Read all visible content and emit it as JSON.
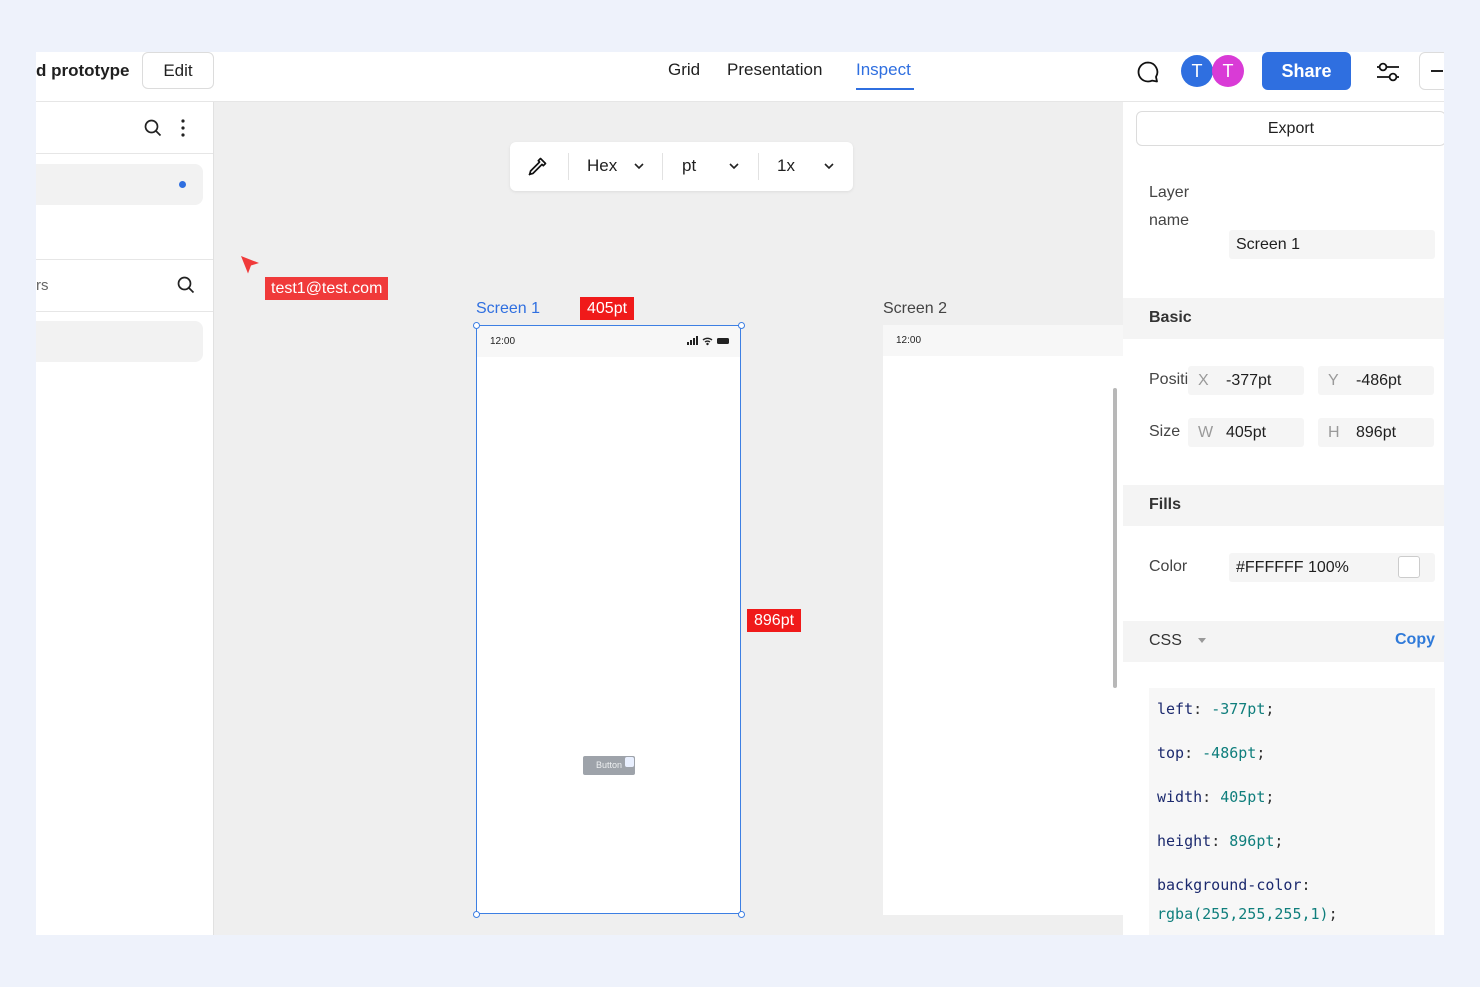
{
  "header": {
    "project_title": "d prototype",
    "edit_label": "Edit",
    "tabs": [
      {
        "label": "Grid"
      },
      {
        "label": "Presentation"
      },
      {
        "label": "Inspect",
        "active": true
      }
    ],
    "avatars": [
      {
        "initial": "T",
        "color": "#2f6fe0"
      },
      {
        "initial": "T",
        "color": "#d93bd6"
      }
    ],
    "share_label": "Share",
    "icons": {
      "comment": "comment-icon",
      "settings": "sliders-icon",
      "more": "minus-icon"
    },
    "accent_color": "#2f6fe0"
  },
  "sidebar": {
    "layers_search_label": "rs"
  },
  "canvas": {
    "toolbar": {
      "color_format": "Hex",
      "unit": "pt",
      "scale": "1x"
    },
    "cursor_user": "test1@test.com",
    "screen1": {
      "label": "Screen 1",
      "width_tag": "405pt",
      "height_tag": "896pt",
      "status_time": "12:00",
      "button_label": "Button"
    },
    "screen2": {
      "label": "Screen 2",
      "status_time": "12:00"
    }
  },
  "panel": {
    "export_label": "Export",
    "layer_name_label": "Layer name",
    "layer_name_value": "Screen 1",
    "basic": {
      "title": "Basic",
      "position_label": "Positi",
      "x_axis": "X",
      "x_value": "-377pt",
      "y_axis": "Y",
      "y_value": "-486pt",
      "size_label": "Size",
      "w_axis": "W",
      "w_value": "405pt",
      "h_axis": "H",
      "h_value": "896pt"
    },
    "fills": {
      "title": "Fills",
      "color_label": "Color",
      "color_value": "#FFFFFF 100%"
    },
    "css": {
      "label": "CSS",
      "copy_label": "Copy",
      "lines": [
        {
          "prop": "left",
          "val": "-377pt"
        },
        {
          "prop": "top",
          "val": "-486pt"
        },
        {
          "prop": "width",
          "val": "405pt"
        },
        {
          "prop": "height",
          "val": "896pt"
        },
        {
          "prop": "background-color",
          "val": "rgba(255,255,255,1)"
        }
      ]
    }
  }
}
